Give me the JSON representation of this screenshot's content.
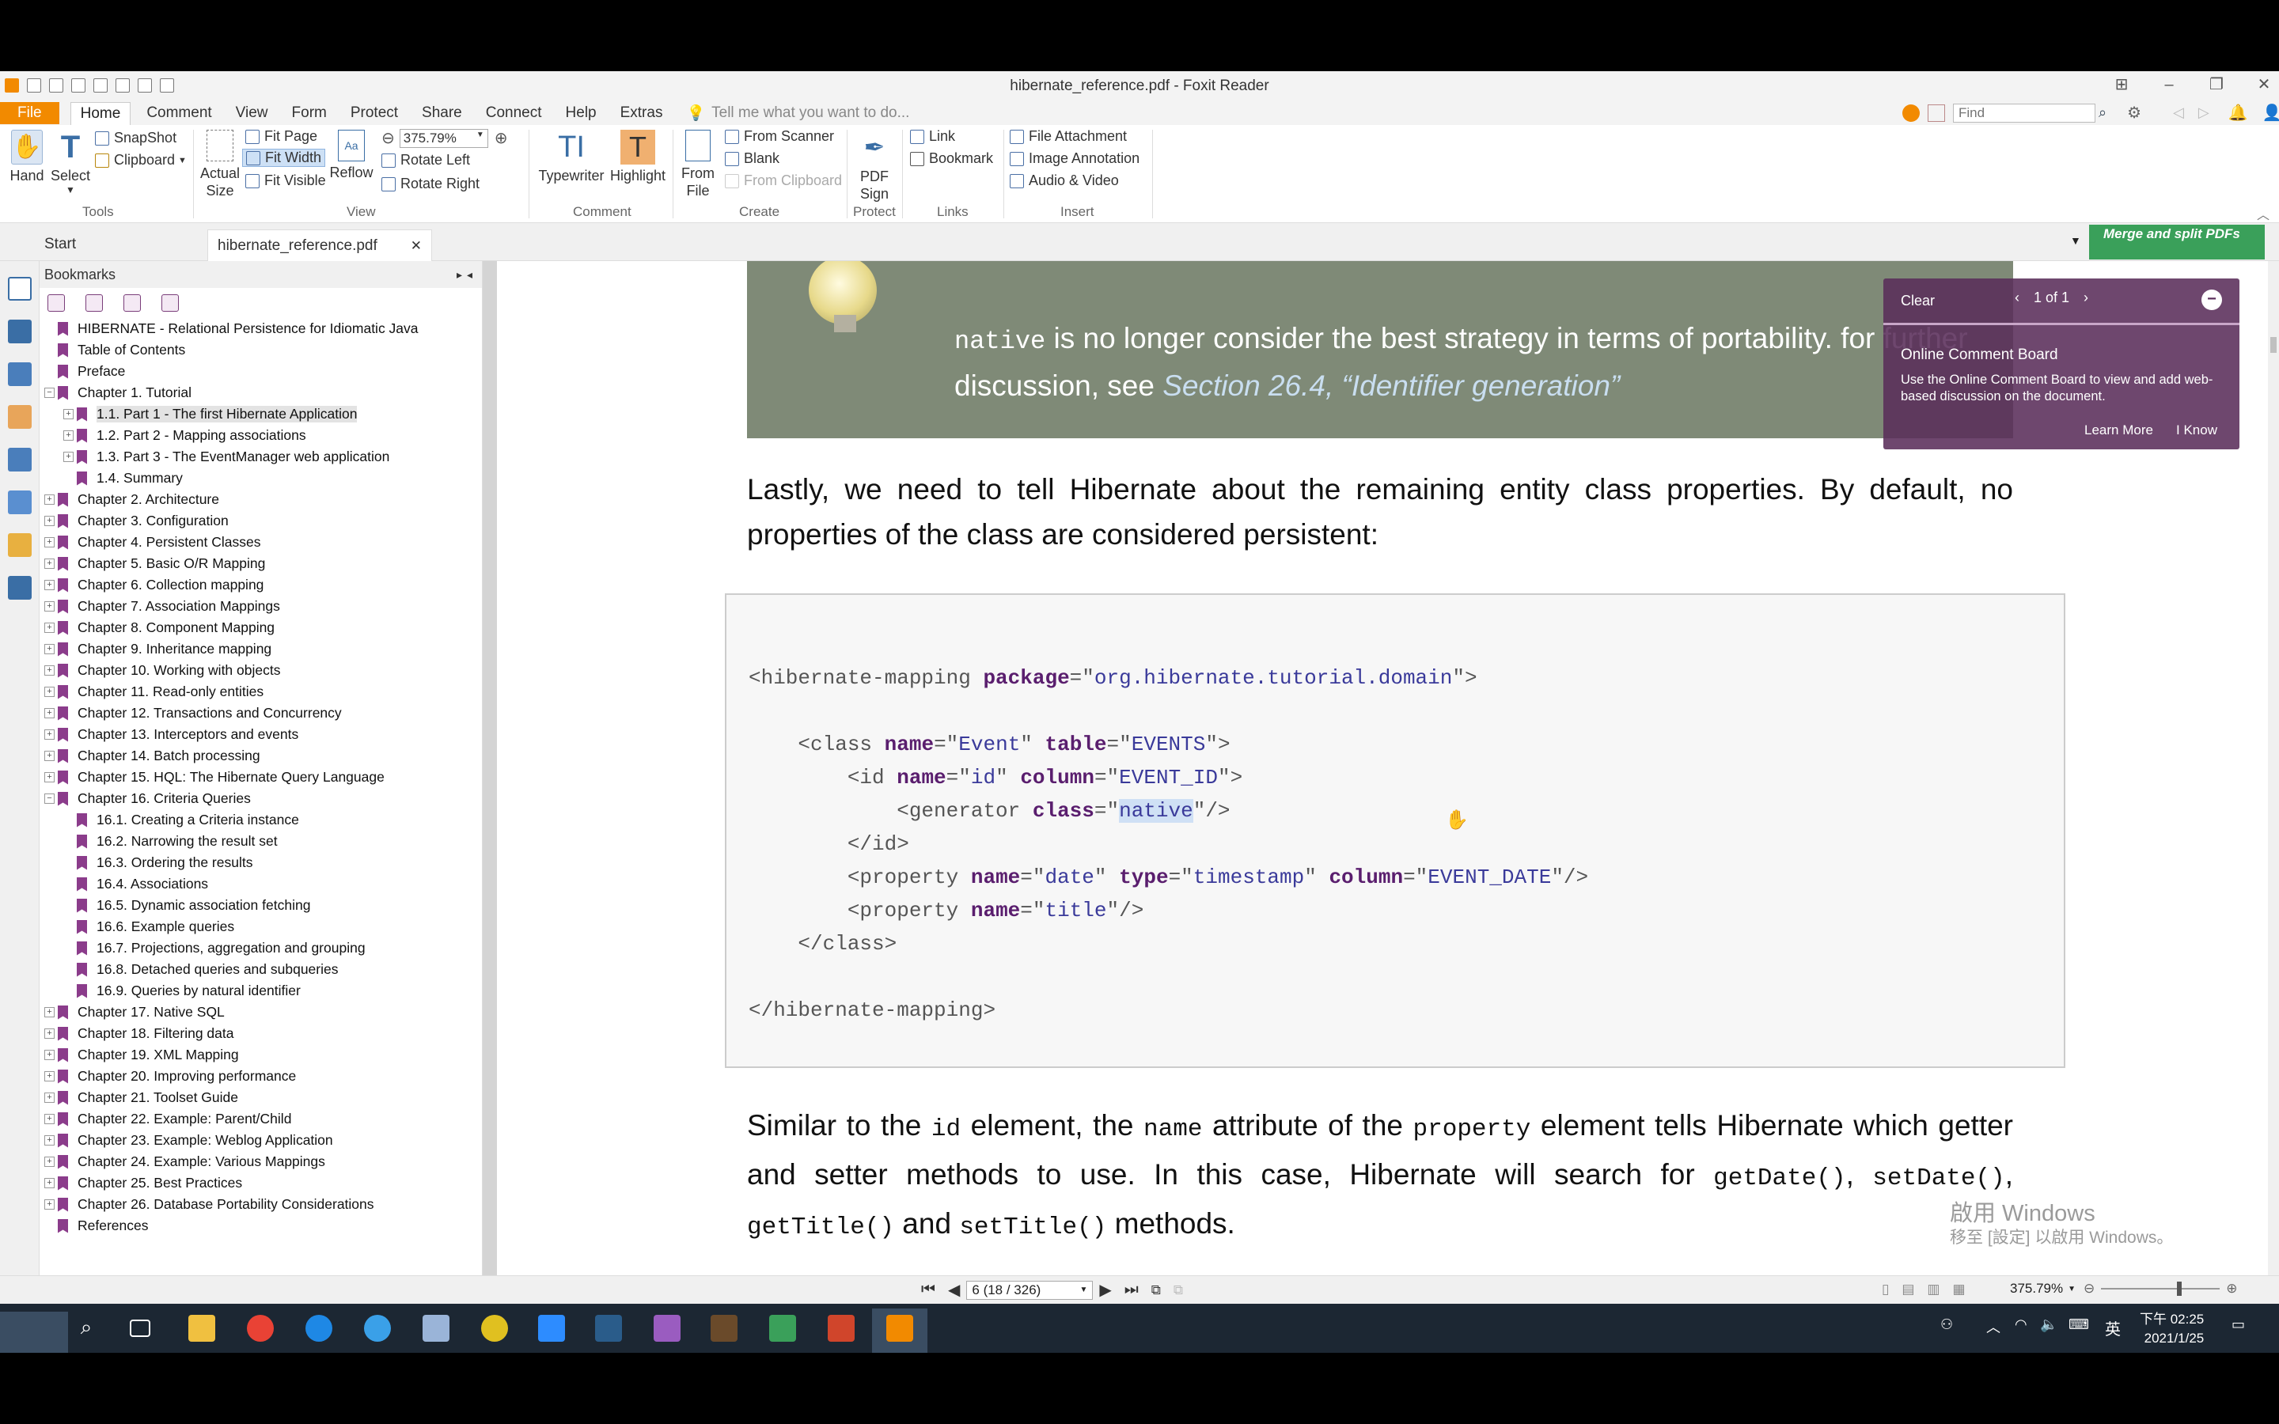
{
  "window": {
    "title": "hibernate_reference.pdf - Foxit Reader"
  },
  "menu": {
    "items": [
      "File",
      "Home",
      "Comment",
      "View",
      "Form",
      "Protect",
      "Share",
      "Connect",
      "Help",
      "Extras"
    ],
    "tell_me": "Tell me what you want to do...",
    "find_placeholder": "Find"
  },
  "ribbon": {
    "tools": {
      "hand": "Hand",
      "select": "Select",
      "snapshot": "SnapShot",
      "clipboard": "Clipboard",
      "label": "Tools"
    },
    "view": {
      "actual_size": "Actual Size",
      "fit_page": "Fit Page",
      "fit_width": "Fit Width",
      "fit_visible": "Fit Visible",
      "reflow": "Reflow",
      "zoom": "375.79%",
      "rotate_left": "Rotate Left",
      "rotate_right": "Rotate Right",
      "label": "View"
    },
    "comment": {
      "typewriter": "Typewriter",
      "highlight": "Highlight",
      "label": "Comment"
    },
    "create": {
      "from_file": "From File",
      "from_scanner": "From Scanner",
      "blank": "Blank",
      "from_clipboard": "From Clipboard",
      "label": "Create"
    },
    "protect": {
      "pdf_sign": "PDF Sign",
      "label": "Protect"
    },
    "links": {
      "link": "Link",
      "bookmark": "Bookmark",
      "label": "Links"
    },
    "insert": {
      "file_attachment": "File Attachment",
      "image_annotation": "Image Annotation",
      "audio_video": "Audio & Video",
      "label": "Insert"
    }
  },
  "tabs": {
    "start": "Start",
    "doc": "hibernate_reference.pdf",
    "close": "✕"
  },
  "merge_badge": "Merge and split PDFs",
  "bookmarks": {
    "title": "Bookmarks",
    "items": [
      {
        "label": "HIBERNATE - Relational Persistence for Idiomatic Java",
        "level": 0,
        "exp": ""
      },
      {
        "label": "Table of Contents",
        "level": 0,
        "exp": ""
      },
      {
        "label": "Preface",
        "level": 0,
        "exp": ""
      },
      {
        "label": "Chapter 1. Tutorial",
        "level": 0,
        "exp": "−"
      },
      {
        "label": "1.1. Part 1 - The first Hibernate Application",
        "level": 1,
        "exp": "+",
        "selected": true
      },
      {
        "label": "1.2. Part 2 - Mapping associations",
        "level": 1,
        "exp": "+"
      },
      {
        "label": "1.3. Part 3 - The EventManager web application",
        "level": 1,
        "exp": "+"
      },
      {
        "label": "1.4. Summary",
        "level": 1,
        "exp": ""
      },
      {
        "label": "Chapter 2. Architecture",
        "level": 0,
        "exp": "+"
      },
      {
        "label": "Chapter 3. Configuration",
        "level": 0,
        "exp": "+"
      },
      {
        "label": "Chapter 4. Persistent Classes",
        "level": 0,
        "exp": "+"
      },
      {
        "label": "Chapter 5. Basic O/R Mapping",
        "level": 0,
        "exp": "+"
      },
      {
        "label": "Chapter 6. Collection mapping",
        "level": 0,
        "exp": "+"
      },
      {
        "label": "Chapter 7. Association Mappings",
        "level": 0,
        "exp": "+"
      },
      {
        "label": "Chapter 8. Component Mapping",
        "level": 0,
        "exp": "+"
      },
      {
        "label": "Chapter 9. Inheritance mapping",
        "level": 0,
        "exp": "+"
      },
      {
        "label": "Chapter 10. Working with objects",
        "level": 0,
        "exp": "+"
      },
      {
        "label": "Chapter 11. Read-only entities",
        "level": 0,
        "exp": "+"
      },
      {
        "label": "Chapter 12. Transactions and Concurrency",
        "level": 0,
        "exp": "+"
      },
      {
        "label": "Chapter 13. Interceptors and events",
        "level": 0,
        "exp": "+"
      },
      {
        "label": "Chapter 14. Batch processing",
        "level": 0,
        "exp": "+"
      },
      {
        "label": "Chapter 15. HQL: The Hibernate Query Language",
        "level": 0,
        "exp": "+"
      },
      {
        "label": "Chapter 16. Criteria Queries",
        "level": 0,
        "exp": "−"
      },
      {
        "label": "16.1. Creating a Criteria instance",
        "level": 1,
        "exp": ""
      },
      {
        "label": "16.2. Narrowing the result set",
        "level": 1,
        "exp": ""
      },
      {
        "label": "16.3. Ordering the results",
        "level": 1,
        "exp": ""
      },
      {
        "label": "16.4. Associations",
        "level": 1,
        "exp": ""
      },
      {
        "label": "16.5. Dynamic association fetching",
        "level": 1,
        "exp": ""
      },
      {
        "label": "16.6. Example queries",
        "level": 1,
        "exp": ""
      },
      {
        "label": "16.7. Projections, aggregation and grouping",
        "level": 1,
        "exp": ""
      },
      {
        "label": "16.8. Detached queries and subqueries",
        "level": 1,
        "exp": ""
      },
      {
        "label": "16.9. Queries by natural identifier",
        "level": 1,
        "exp": ""
      },
      {
        "label": "Chapter 17. Native SQL",
        "level": 0,
        "exp": "+"
      },
      {
        "label": "Chapter 18. Filtering data",
        "level": 0,
        "exp": "+"
      },
      {
        "label": "Chapter 19. XML Mapping",
        "level": 0,
        "exp": "+"
      },
      {
        "label": "Chapter 20. Improving performance",
        "level": 0,
        "exp": "+"
      },
      {
        "label": "Chapter 21. Toolset Guide",
        "level": 0,
        "exp": "+"
      },
      {
        "label": "Chapter 22. Example: Parent/Child",
        "level": 0,
        "exp": "+"
      },
      {
        "label": "Chapter 23. Example: Weblog Application",
        "level": 0,
        "exp": "+"
      },
      {
        "label": "Chapter 24. Example: Various Mappings",
        "level": 0,
        "exp": "+"
      },
      {
        "label": "Chapter 25. Best Practices",
        "level": 0,
        "exp": "+"
      },
      {
        "label": "Chapter 26. Database Portability Considerations",
        "level": 0,
        "exp": "+"
      },
      {
        "label": "References",
        "level": 0,
        "exp": ""
      }
    ]
  },
  "document": {
    "note": {
      "code": "native",
      "text1": " is no longer consider the best strategy in terms of portability. for further discussion, see ",
      "link": "Section 26.4, “Identifier generation”"
    },
    "para1": "Lastly, we need to tell Hibernate about the remaining entity class properties. By default, no properties of the class are considered persistent:",
    "para2": {
      "t1": "Similar to the ",
      "c1": "id",
      "t2": " element, the ",
      "c2": "name",
      "t3": " attribute of the ",
      "c3": "property",
      "t4": " element tells Hibernate which getter and setter methods to use. In this case, Hibernate will search for ",
      "c4": "getDate()",
      "t5": ", ",
      "c5": "setDate()",
      "t6": ", ",
      "c6": "getTitle()",
      "t7": " and ",
      "c7": "setTitle()",
      "t8": " methods."
    }
  },
  "comment_board": {
    "clear": "Clear",
    "pager": "1 of 1",
    "title": "Online Comment Board",
    "body": "Use the Online Comment Board to view and add web-based discussion on the document.",
    "learn_more": "Learn More",
    "i_know": "I Know"
  },
  "statusbar": {
    "page": "6 (18 / 326)",
    "zoom": "375.79%"
  },
  "watermark": {
    "line1": "啟用 Windows",
    "line2": "移至 [設定] 以啟用 Windows。"
  },
  "taskbar": {
    "time": "下午 02:25",
    "date": "2021/1/25",
    "ime": "英"
  },
  "colors": {
    "accent": "#f28a00",
    "bookmark_flag": "#8b3c8b",
    "note_bg": "#7f8a77",
    "merge_badge": "#3aa05a",
    "taskbar": "#1c2733"
  }
}
